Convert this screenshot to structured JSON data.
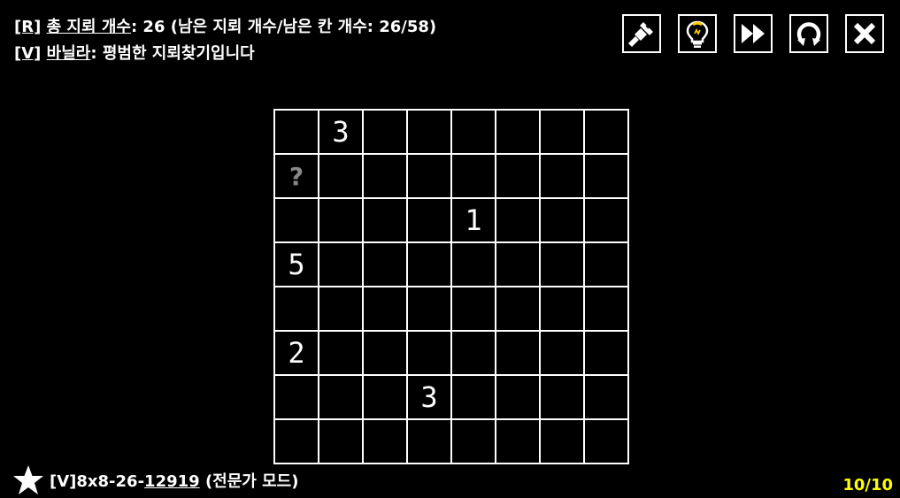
{
  "header": {
    "line1_tag": "[R]",
    "line1_label": "총 지뢰 개수",
    "line1_rest": ":  26 (남은 지뢰 개수/남은 칸 개수: 26/58)",
    "line2_tag": "[V]",
    "line2_label": "바닐라",
    "line2_rest": ": 평범한 지뢰찾기입니다"
  },
  "toolbar": {
    "buttons": [
      {
        "icon": "paintbrush-icon"
      },
      {
        "icon": "lightbulb-icon"
      },
      {
        "icon": "fast-forward-icon"
      },
      {
        "icon": "restart-icon"
      },
      {
        "icon": "close-icon"
      }
    ],
    "accent_color": "#ffcc00"
  },
  "board": {
    "rows": 8,
    "cols": 8,
    "cells": [
      [
        "",
        "3",
        "",
        "",
        "",
        "",
        "",
        ""
      ],
      [
        "?",
        "",
        "",
        "",
        "",
        "",
        "",
        ""
      ],
      [
        "",
        "",
        "",
        "",
        "1",
        "",
        "",
        ""
      ],
      [
        "5",
        "",
        "",
        "",
        "",
        "",
        "",
        ""
      ],
      [
        "",
        "",
        "",
        "",
        "",
        "",
        "",
        ""
      ],
      [
        "2",
        "",
        "",
        "",
        "",
        "",
        "",
        ""
      ],
      [
        "",
        "",
        "",
        "3",
        "",
        "",
        "",
        ""
      ],
      [
        "",
        "",
        "",
        "",
        "",
        "",
        "",
        ""
      ]
    ]
  },
  "footer": {
    "star_icon": "star-icon",
    "puzzle_prefix": "[V]8x8-26-",
    "puzzle_id": "12919",
    "puzzle_suffix": " (전문가 모드)",
    "progress": "10/10",
    "progress_color": "#ffff00"
  }
}
